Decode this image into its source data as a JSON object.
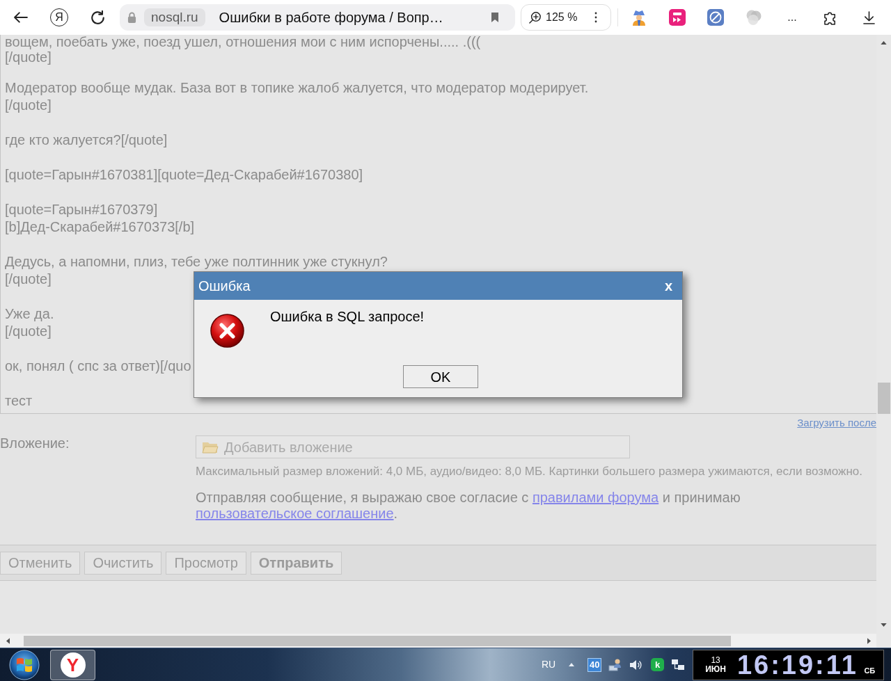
{
  "browser_toolbar": {
    "home_glyph": "Я",
    "domain": "nosql.ru",
    "page_title": "Ошибки в работе форума / Вопр…",
    "zoom": "125 %",
    "extensions_more": "..."
  },
  "message_paragraphs": [
    [
      "вощем, поебать уже, поезд ушел, отношения мои с ним испорчены..... .(((",
      "[/quote]"
    ],
    [
      "Модератор вообще мудак. База вот в топике жалоб жалуется, что модератор модерирует.",
      "[/quote]"
    ],
    [
      "где кто жалуется?[/quote]"
    ],
    [
      "[quote=Гарын#1670381][quote=Дед-Скарабей#1670380]"
    ],
    [
      "[quote=Гарын#1670379]",
      "[b]Дед-Скарабей#1670373[/b]"
    ],
    [
      "Дедусь, а напомни, плиз, тебе уже полтинник уже стукнул?",
      "[/quote]"
    ],
    [
      "Уже да.",
      "[/quote]"
    ],
    [
      "ок, понял ( спс за ответ)[/quo"
    ],
    [
      "тест"
    ]
  ],
  "upload_later_link": "Загрузить после",
  "attachment": {
    "label": "Вложение:",
    "button": "Добавить вложение",
    "hint": "Максимальный размер вложений: 4,0 МБ, аудио/видео: 8,0 МБ. Картинки большего размера ужимаются, если возможно."
  },
  "consent": {
    "text": "Отправляя сообщение, я выражаю свое согласие с",
    "rules_link": "правилами форума",
    "text_2": "и принимаю",
    "agreement_link": "пользовательское соглашение",
    "ending": "."
  },
  "form_buttons": [
    {
      "label": "Отменить",
      "primary": false
    },
    {
      "label": "Очистить",
      "primary": false
    },
    {
      "label": "Просмотр",
      "primary": false
    },
    {
      "label": "Отправить",
      "primary": true
    }
  ],
  "dialog": {
    "title": "Ошибка",
    "close": "x",
    "message": "Ошибка в SQL запросе!",
    "button": "OK"
  },
  "taskbar": {
    "app_glyph": "Y",
    "language": "RU",
    "tray_badge": "40",
    "tray_app_glyph": "k",
    "clock": {
      "day": "13",
      "month": "ИЮН",
      "time": "16:19:11",
      "weekday": "СБ"
    }
  }
}
